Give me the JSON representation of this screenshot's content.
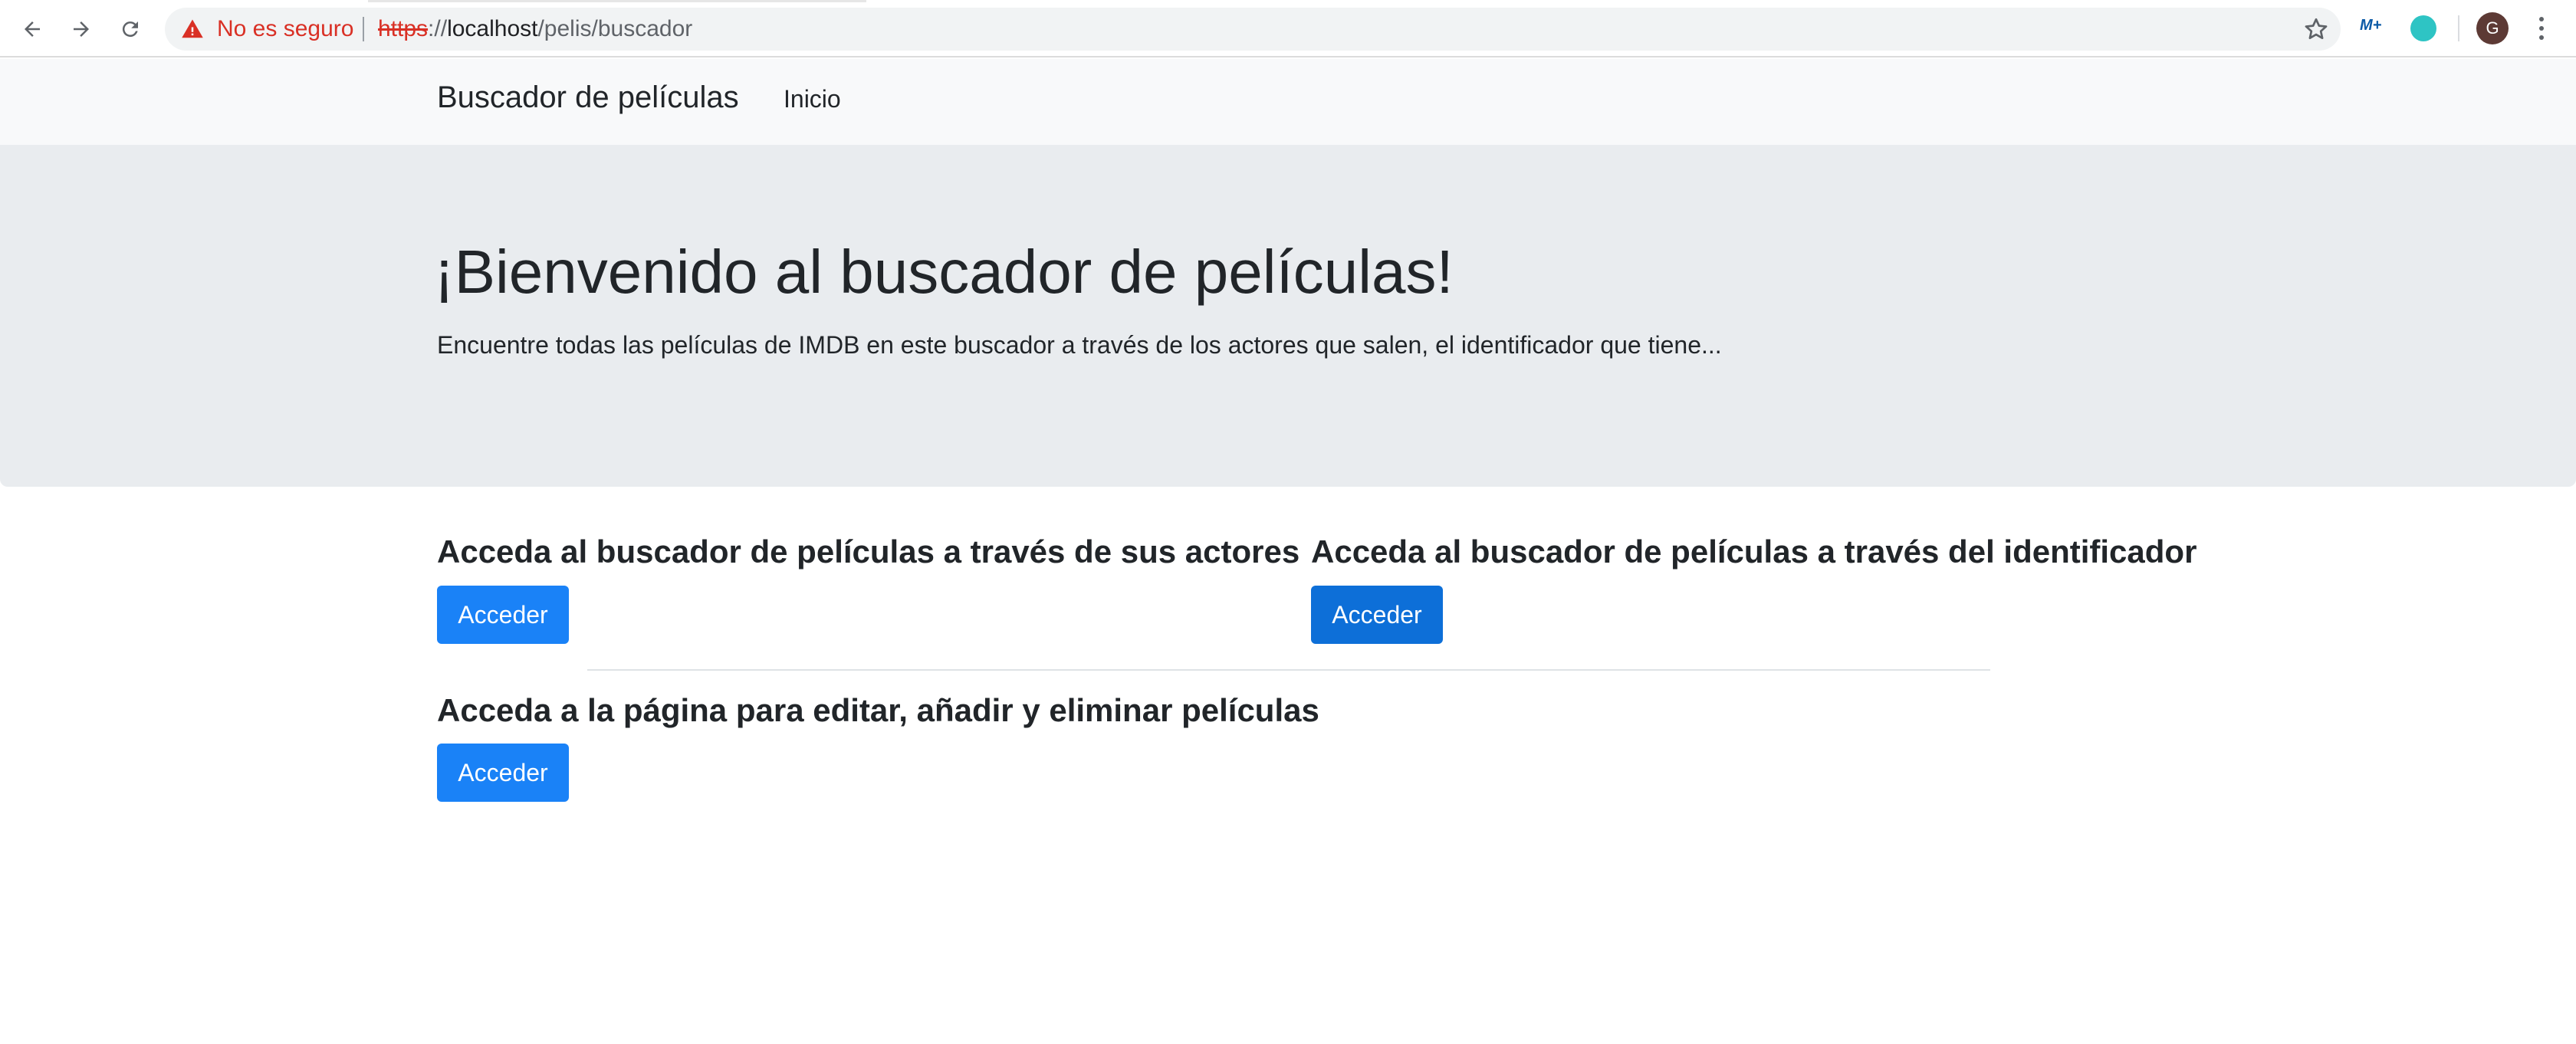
{
  "browser": {
    "security_label": "No es seguro",
    "url_scheme": "https",
    "url_separator": "://",
    "url_host": "localhost",
    "url_path": "/pelis/buscador",
    "avatar_initial": "G",
    "icons": [
      "back-icon",
      "forward-icon",
      "reload-icon",
      "warning-icon",
      "star-icon",
      "movistar-extension-icon",
      "extension-icon",
      "avatar",
      "menu-icon"
    ]
  },
  "navbar": {
    "brand": "Buscador de películas",
    "links": [
      {
        "label": "Inicio"
      }
    ]
  },
  "jumbotron": {
    "title": "¡Bienvenido al buscador de películas!",
    "lead": "Encuentre todas las películas de IMDB en este buscador a través de los actores que salen, el identificador que tiene..."
  },
  "sections": [
    {
      "title": "Acceda al buscador de películas a través de sus actores",
      "button": "Acceder"
    },
    {
      "title": "Acceda al buscador de películas a través del identificador",
      "button": "Acceder"
    },
    {
      "title": "Acceda a la página para editar, añadir y eliminar películas",
      "button": "Acceder"
    }
  ],
  "colors": {
    "primary": "#1a82f7",
    "primary_active": "#0d6fd8",
    "jumbotron_bg": "#e9ecef",
    "navbar_bg": "#f8f9fa",
    "warning": "#d93025"
  }
}
